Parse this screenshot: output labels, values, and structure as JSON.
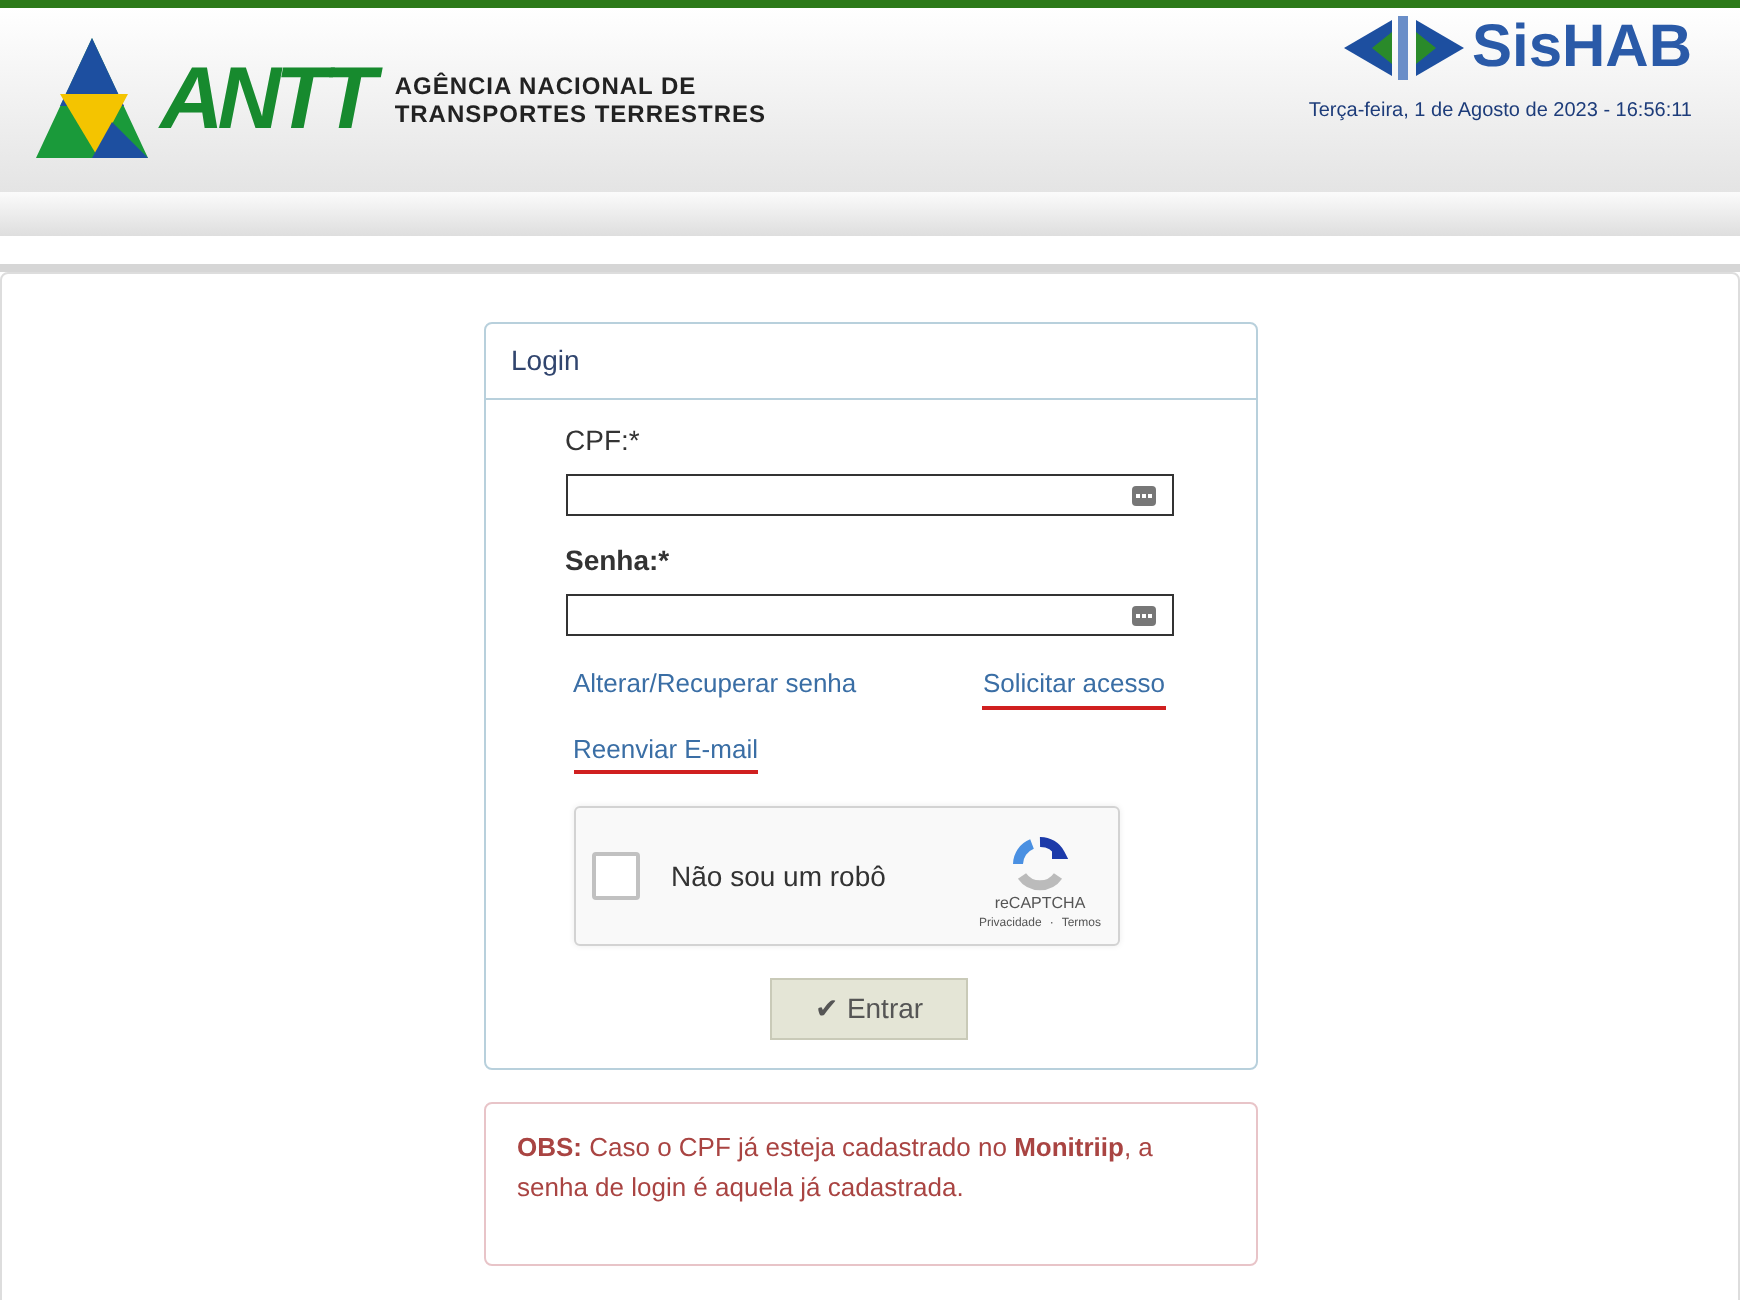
{
  "header": {
    "logo_text": "ANTT",
    "agency_lines": [
      "AGÊNCIA NACIONAL DE",
      "TRANSPORTES TERRESTRES"
    ],
    "system_name": "SisHAB",
    "datetime": "Terça-feira, 1 de Agosto de 2023 - 16:56:11"
  },
  "login": {
    "title": "Login",
    "fields": [
      {
        "label": "CPF:*",
        "bold": false
      },
      {
        "label": "Senha:*",
        "bold": true
      }
    ],
    "link_rows": [
      [
        {
          "text": "Alterar/Recuperar senha",
          "marked": false
        },
        {
          "text": "Solicitar acesso",
          "marked": true
        }
      ],
      [
        {
          "text": "Reenviar E-mail",
          "marked": true
        }
      ]
    ],
    "captcha": {
      "label": "Não sou um robô",
      "checked": false,
      "brand": "reCAPTCHA",
      "privacy": "Privacidade",
      "separator": "·",
      "terms": "Termos"
    },
    "submit": {
      "icon": "✔",
      "label": "Entrar"
    }
  },
  "notice": "**OBS:** Caso o CPF já esteja cadastrado no **Monitriip**, a senha de login é aquela já cadastrada."
}
